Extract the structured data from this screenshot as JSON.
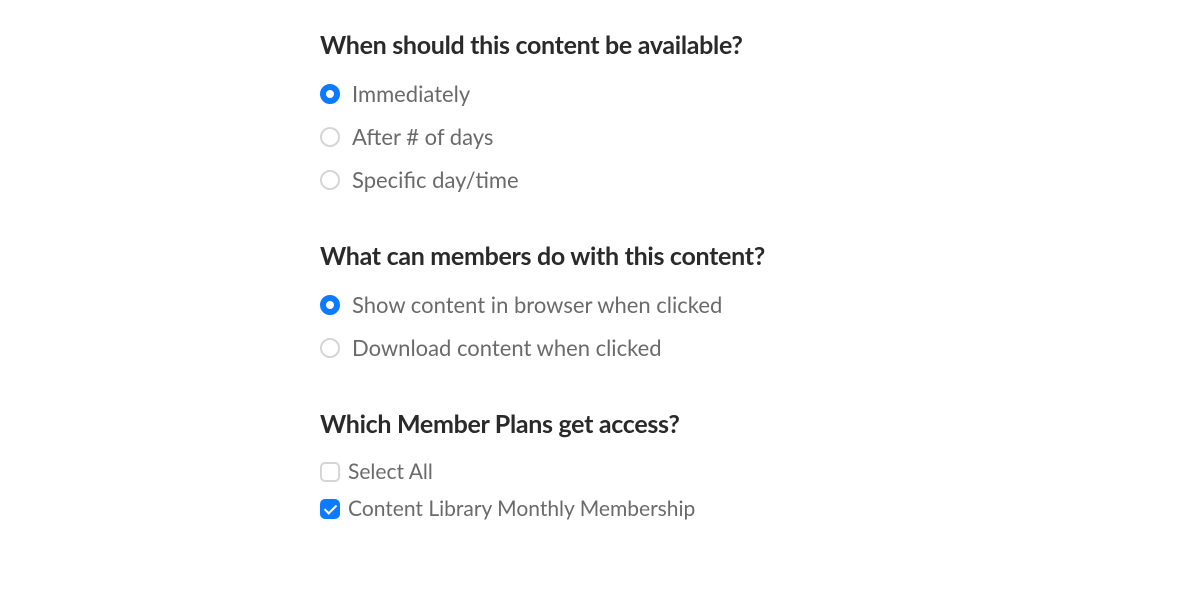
{
  "availability": {
    "heading": "When should this content be available?",
    "options": [
      {
        "label": "Immediately",
        "selected": true
      },
      {
        "label": "After # of days",
        "selected": false
      },
      {
        "label": "Specific day/time",
        "selected": false
      }
    ]
  },
  "permissions": {
    "heading": "What can members do with this content?",
    "options": [
      {
        "label": "Show content in browser when clicked",
        "selected": true
      },
      {
        "label": "Download content when clicked",
        "selected": false
      }
    ]
  },
  "plans": {
    "heading": "Which Member Plans get access?",
    "options": [
      {
        "label": "Select All",
        "checked": false
      },
      {
        "label": "Content Library Monthly Membership",
        "checked": true
      }
    ]
  }
}
